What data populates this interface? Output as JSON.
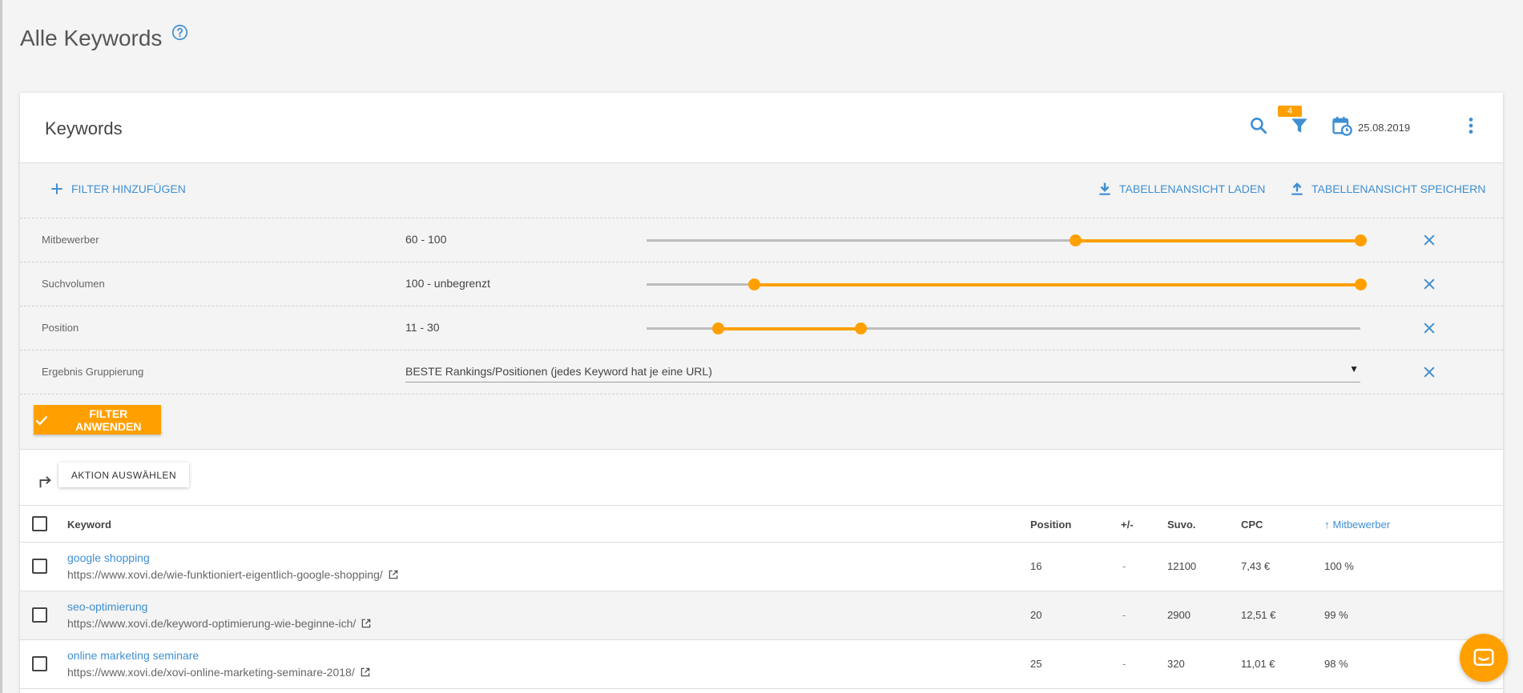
{
  "page": {
    "title": "Alle Keywords"
  },
  "card": {
    "title": "Keywords",
    "filter_count": "4",
    "date": "25.08.2019"
  },
  "toolbar": {
    "add_filter": "Filter hinzufügen",
    "load_view": "Tabellenansicht laden",
    "save_view": "Tabellenansicht speichern"
  },
  "filters": [
    {
      "label": "Mitbewerber",
      "value": "60 - 100",
      "range": [
        0.6,
        1.0
      ]
    },
    {
      "label": "Suchvolumen",
      "value": "100 - unbegrenzt",
      "range": [
        0.15,
        1.0
      ]
    },
    {
      "label": "Position",
      "value": "11 - 30",
      "range": [
        0.1,
        0.3
      ]
    },
    {
      "label": "Ergebnis Gruppierung",
      "value": "BESTE Rankings/Positionen (jedes Keyword hat je eine URL)"
    }
  ],
  "apply_label": "Filter anwenden",
  "action_label": "AKTION AUSWÄHLEN",
  "table": {
    "headers": {
      "keyword": "Keyword",
      "position": "Position",
      "change": "+/-",
      "suvo": "Suvo.",
      "cpc": "CPC",
      "competitors": "Mitbewerber"
    },
    "rows": [
      {
        "keyword": "google shopping",
        "url": "https://www.xovi.de/wie-funktioniert-eigentlich-google-shopping/",
        "position": "16",
        "change": "-",
        "suvo": "12100",
        "cpc": "7,43 €",
        "competitors": "100 %"
      },
      {
        "keyword": "seo-optimierung",
        "url": "https://www.xovi.de/keyword-optimierung-wie-beginne-ich/",
        "position": "20",
        "change": "-",
        "suvo": "2900",
        "cpc": "12,51 €",
        "competitors": "99 %"
      },
      {
        "keyword": "online marketing seminare",
        "url": "https://www.xovi.de/xovi-online-marketing-seminare-2018/",
        "position": "25",
        "change": "-",
        "suvo": "320",
        "cpc": "11,01 €",
        "competitors": "98 %"
      }
    ]
  },
  "colors": {
    "accent": "#ffa000",
    "link": "#3f8fd2"
  },
  "icons": [
    "help-icon",
    "search-icon",
    "filter-icon",
    "calendar-icon",
    "more-vert-icon",
    "plus-icon",
    "download-icon",
    "upload-icon",
    "close-icon",
    "check-icon",
    "redirect-arrow-icon",
    "arrow-up-icon",
    "open-in-new-icon",
    "chat-icon"
  ]
}
